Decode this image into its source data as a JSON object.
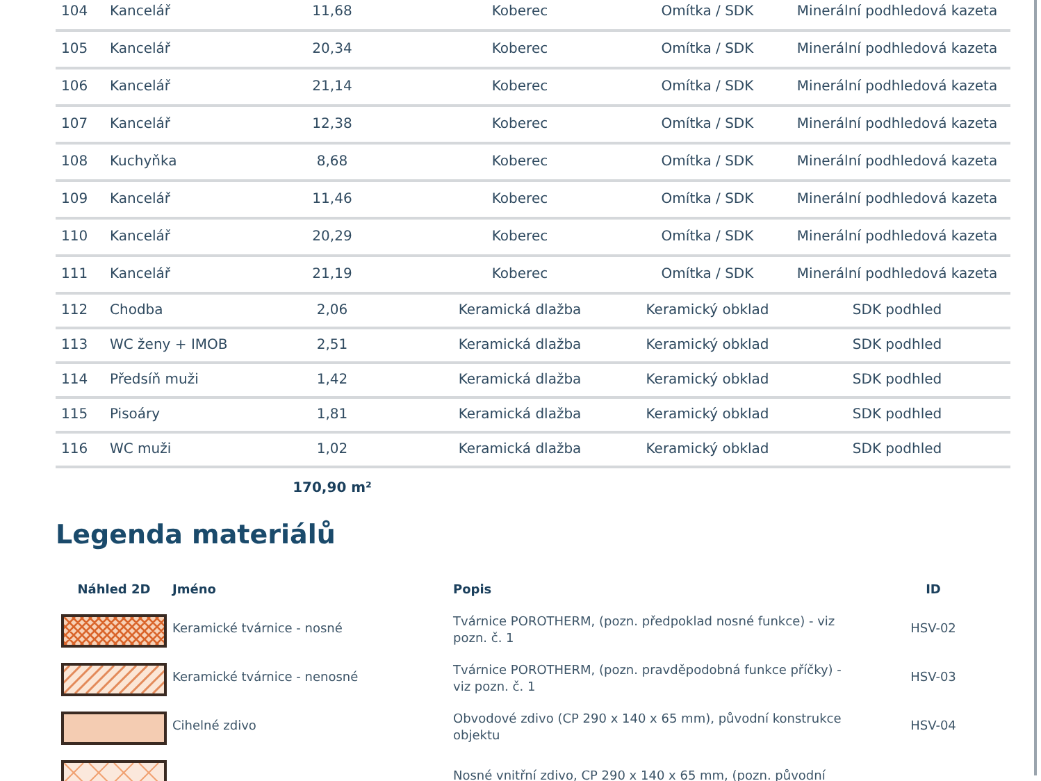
{
  "rooms": {
    "rows": [
      {
        "number": "104",
        "name": "Kancelář",
        "area": "11,68",
        "floor": "Koberec",
        "walls": "Omítka / SDK",
        "ceiling": "Minerální podhledová kazeta"
      },
      {
        "number": "105",
        "name": "Kancelář",
        "area": "20,34",
        "floor": "Koberec",
        "walls": "Omítka / SDK",
        "ceiling": "Minerální podhledová kazeta"
      },
      {
        "number": "106",
        "name": "Kancelář",
        "area": "21,14",
        "floor": "Koberec",
        "walls": "Omítka / SDK",
        "ceiling": "Minerální podhledová kazeta"
      },
      {
        "number": "107",
        "name": "Kancelář",
        "area": "12,38",
        "floor": "Koberec",
        "walls": "Omítka / SDK",
        "ceiling": "Minerální podhledová kazeta"
      },
      {
        "number": "108",
        "name": "Kuchyňka",
        "area": "8,68",
        "floor": "Koberec",
        "walls": "Omítka / SDK",
        "ceiling": "Minerální podhledová kazeta"
      },
      {
        "number": "109",
        "name": "Kancelář",
        "area": "11,46",
        "floor": "Koberec",
        "walls": "Omítka / SDK",
        "ceiling": "Minerální podhledová kazeta"
      },
      {
        "number": "110",
        "name": "Kancelář",
        "area": "20,29",
        "floor": "Koberec",
        "walls": "Omítka / SDK",
        "ceiling": "Minerální podhledová kazeta"
      },
      {
        "number": "111",
        "name": "Kancelář",
        "area": "21,19",
        "floor": "Koberec",
        "walls": "Omítka / SDK",
        "ceiling": "Minerální podhledová kazeta"
      },
      {
        "number": "112",
        "name": "Chodba",
        "area": "2,06",
        "floor": "Keramická dlažba",
        "walls": "Keramický obklad",
        "ceiling": "SDK podhled"
      },
      {
        "number": "113",
        "name": "WC ženy + IMOB",
        "area": "2,51",
        "floor": "Keramická dlažba",
        "walls": "Keramický obklad",
        "ceiling": "SDK podhled"
      },
      {
        "number": "114",
        "name": "Předsíň muži",
        "area": "1,42",
        "floor": "Keramická dlažba",
        "walls": "Keramický obklad",
        "ceiling": "SDK podhled"
      },
      {
        "number": "115",
        "name": "Pisoáry",
        "area": "1,81",
        "floor": "Keramická dlažba",
        "walls": "Keramický obklad",
        "ceiling": "SDK podhled"
      },
      {
        "number": "116",
        "name": "WC muži",
        "area": "1,02",
        "floor": "Keramická dlažba",
        "walls": "Keramický obklad",
        "ceiling": "SDK podhled"
      }
    ],
    "total": "170,90 m²"
  },
  "legend": {
    "title": "Legenda materiálů",
    "columns": [
      "Náhled 2D",
      "Jméno",
      "Popis",
      "ID"
    ],
    "rows": [
      {
        "kind": "crosshatch",
        "name": "Keramické tvárnice - nosné",
        "description": "Tvárnice POROTHERM, (pozn. předpoklad nosné funkce) - viz pozn. č. 1",
        "id": "HSV-02"
      },
      {
        "kind": "hatch",
        "name": "Keramické tvárnice - nenosné",
        "description": "Tvárnice POROTHERM, (pozn. pravděpodobná funkce příčky) - viz pozn. č. 1",
        "id": "HSV-03"
      },
      {
        "kind": "solid",
        "name": "Cihelné zdivo",
        "description": "Obvodové zdivo (CP 290 x 140 x 65 mm), původní konstrukce objektu",
        "id": "HSV-04"
      },
      {
        "kind": "cross",
        "description": "Nosné vnitřní zdivo, CP 290 x 140 x 65 mm, (pozn. původní"
      }
    ]
  }
}
